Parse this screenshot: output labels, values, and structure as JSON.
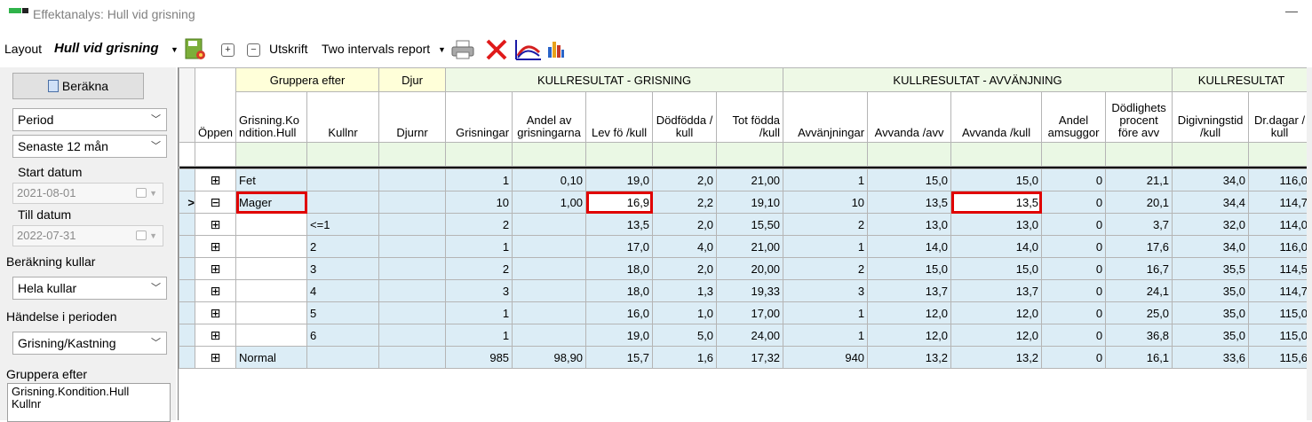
{
  "window": {
    "title": "Effektanalys: Hull vid grisning"
  },
  "toolbar": {
    "layout_label": "Layout",
    "layout_value": "Hull vid grisning",
    "expand_symbol": "+",
    "collapse_symbol": "−",
    "print_label": "Utskrift",
    "report_value": "Two intervals report"
  },
  "left": {
    "calculate_label": "Beräkna",
    "period_select": "Period",
    "range_select": "Senaste 12 mån",
    "start_label": "Start datum",
    "start_value": "2021-08-01",
    "end_label": "Till datum",
    "end_value": "2022-07-31",
    "calc_litters_label": "Beräkning kullar",
    "calc_litters_value": "Hela kullar",
    "event_label": "Händelse i perioden",
    "event_value": "Grisning/Kastning",
    "group_label": "Gruppera efter",
    "group_items": [
      "Grisning.Kondition.Hull",
      "Kullnr"
    ]
  },
  "grid": {
    "groups": {
      "group_by": "Gruppera efter",
      "animal": "Djur",
      "farrowing": "KULLRESULTAT - GRISNING",
      "weaning": "KULLRESULTAT - AVVÄNJNING",
      "result": "KULLRESULTAT"
    },
    "columns": {
      "open": "Öppen",
      "condition": "Grisning.Kondition.Hull",
      "kullnr": "Kullnr",
      "djurnr": "Djurnr",
      "grisningar": "Grisningar",
      "andel": "Andel av grisningarna",
      "levfo": "Lev fö /kull",
      "dodfodda": "Dödfödda / kull",
      "totfodda": "Tot födda /kull",
      "avvanjningar": "Avvänjningar",
      "avvanda_avv": "Avvanda /avv",
      "avvanda_kull": "Avvanda /kull",
      "amsuggor": "Andel amsuggor",
      "dodlighet": "Dödlighets procent före avv",
      "digivning": "Digivningstid /kull",
      "drdagar": "Dr.dagar / kull"
    },
    "rows": [
      {
        "expander": "⊞",
        "cond": "Fet",
        "kull": "",
        "grisn": "1",
        "andel": "0,10",
        "levfo": "19,0",
        "dod": "2,0",
        "tot": "21,00",
        "avv": "1",
        "avvavv": "15,0",
        "avvkull": "15,0",
        "ams": "0",
        "doproc": "21,1",
        "digiv": "34,0",
        "drd": "116,0"
      },
      {
        "expander": "⊟",
        "pointer": ">",
        "cond": "Mager",
        "kull": "",
        "grisn": "10",
        "andel": "1,00",
        "levfo": "16,9",
        "dod": "2,2",
        "tot": "19,10",
        "avv": "10",
        "avvavv": "13,5",
        "avvkull": "13,5",
        "ams": "0",
        "doproc": "20,1",
        "digiv": "34,4",
        "drd": "114,7"
      },
      {
        "expander": "⊞",
        "cond": "",
        "kull": "<=1",
        "grisn": "2",
        "andel": "",
        "levfo": "13,5",
        "dod": "2,0",
        "tot": "15,50",
        "avv": "2",
        "avvavv": "13,0",
        "avvkull": "13,0",
        "ams": "0",
        "doproc": "3,7",
        "digiv": "32,0",
        "drd": "114,0"
      },
      {
        "expander": "⊞",
        "cond": "",
        "kull": "2",
        "grisn": "1",
        "andel": "",
        "levfo": "17,0",
        "dod": "4,0",
        "tot": "21,00",
        "avv": "1",
        "avvavv": "14,0",
        "avvkull": "14,0",
        "ams": "0",
        "doproc": "17,6",
        "digiv": "34,0",
        "drd": "116,0"
      },
      {
        "expander": "⊞",
        "cond": "",
        "kull": "3",
        "grisn": "2",
        "andel": "",
        "levfo": "18,0",
        "dod": "2,0",
        "tot": "20,00",
        "avv": "2",
        "avvavv": "15,0",
        "avvkull": "15,0",
        "ams": "0",
        "doproc": "16,7",
        "digiv": "35,5",
        "drd": "114,5"
      },
      {
        "expander": "⊞",
        "cond": "",
        "kull": "4",
        "grisn": "3",
        "andel": "",
        "levfo": "18,0",
        "dod": "1,3",
        "tot": "19,33",
        "avv": "3",
        "avvavv": "13,7",
        "avvkull": "13,7",
        "ams": "0",
        "doproc": "24,1",
        "digiv": "35,0",
        "drd": "114,7"
      },
      {
        "expander": "⊞",
        "cond": "",
        "kull": "5",
        "grisn": "1",
        "andel": "",
        "levfo": "16,0",
        "dod": "1,0",
        "tot": "17,00",
        "avv": "1",
        "avvavv": "12,0",
        "avvkull": "12,0",
        "ams": "0",
        "doproc": "25,0",
        "digiv": "35,0",
        "drd": "115,0"
      },
      {
        "expander": "⊞",
        "cond": "",
        "kull": "6",
        "grisn": "1",
        "andel": "",
        "levfo": "19,0",
        "dod": "5,0",
        "tot": "24,00",
        "avv": "1",
        "avvavv": "12,0",
        "avvkull": "12,0",
        "ams": "0",
        "doproc": "36,8",
        "digiv": "35,0",
        "drd": "115,0"
      },
      {
        "expander": "⊞",
        "cond": "Normal",
        "kull": "",
        "grisn": "985",
        "andel": "98,90",
        "levfo": "15,7",
        "dod": "1,6",
        "tot": "17,32",
        "avv": "940",
        "avvavv": "13,2",
        "avvkull": "13,2",
        "ams": "0",
        "doproc": "16,1",
        "digiv": "33,6",
        "drd": "115,6"
      }
    ]
  }
}
